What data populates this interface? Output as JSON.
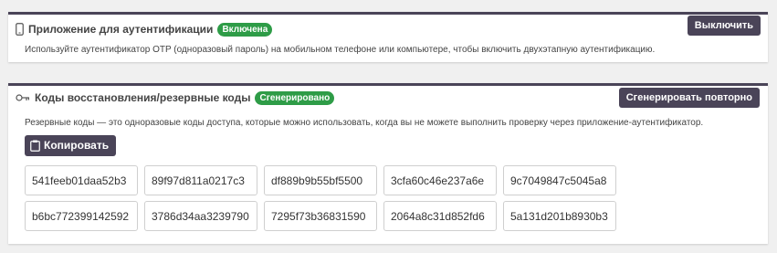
{
  "auth_app": {
    "title": "Приложение для аутентификации",
    "badge": "Включена",
    "button": "Выключить",
    "description": "Используйте аутентификатор OTP (одноразовый пароль) на мобильном телефоне или компьютере, чтобы включить двухэтапную аутентификацию."
  },
  "recovery": {
    "title": "Коды восстановления/резервные коды",
    "badge": "Сгенерировано",
    "button": "Сгенерировать повторно",
    "description": "Резервные коды — это одноразовые коды доступа, которые можно использовать, когда вы не можете выполнить проверку через приложение-аутентификатор.",
    "copy_button": "Копировать",
    "codes": [
      "541feeb01daa52b3",
      "89f97d811a0217c3",
      "df889b9b55bf5500",
      "3cfa60c46e237a6e",
      "9c7049847c5045a8",
      "b6bc772399142592",
      "3786d34aa3239790",
      "7295f73b36831590",
      "2064a8c31d852fd6",
      "5a131d201b8930b3"
    ]
  },
  "colors": {
    "accent": "#4a4458",
    "success": "#2e9c47"
  },
  "icons": {
    "auth": "mobile-phone-icon",
    "recovery": "key-icon",
    "copy": "clipboard-icon"
  }
}
